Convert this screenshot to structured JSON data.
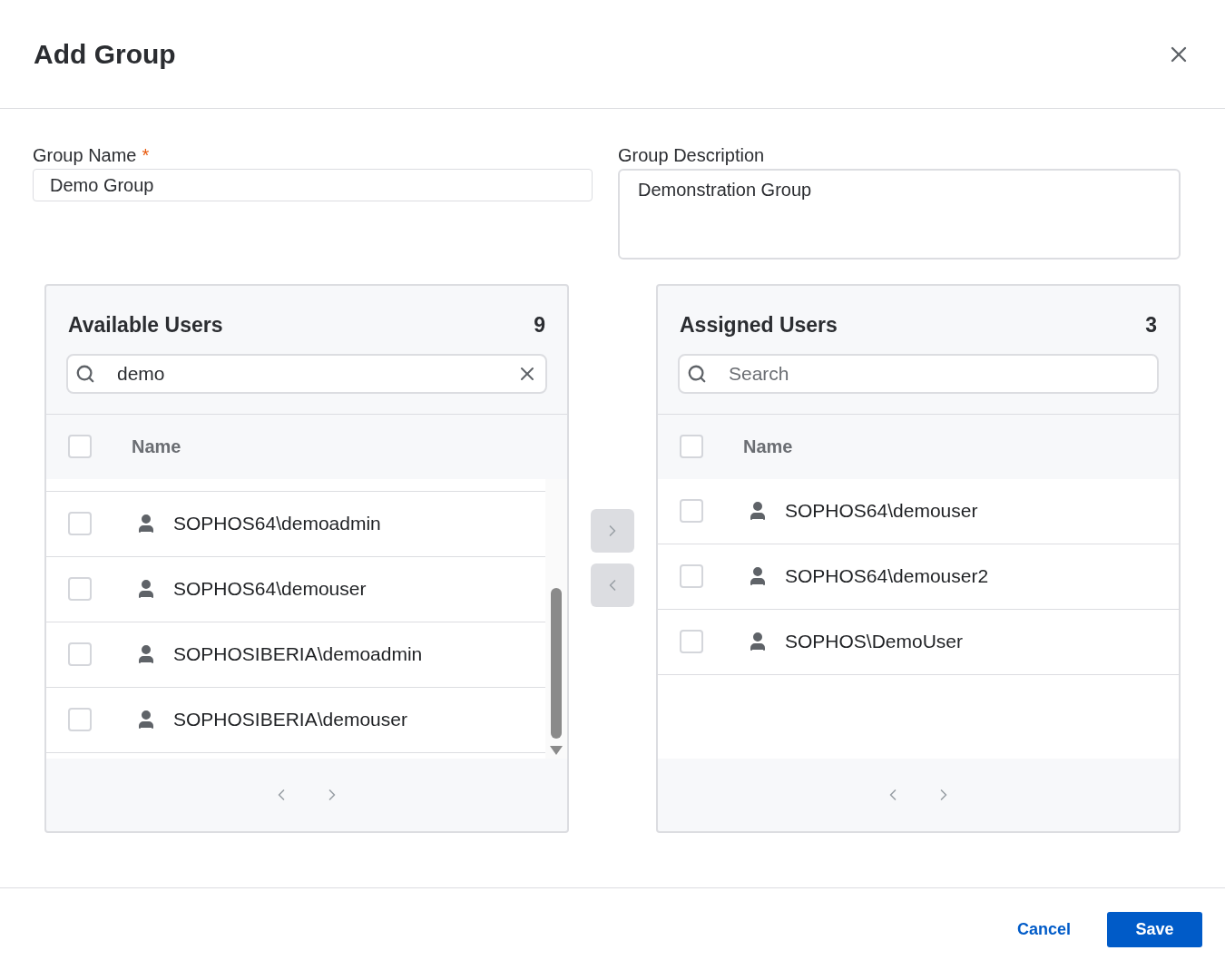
{
  "dialog": {
    "title": "Add Group"
  },
  "fields": {
    "name": {
      "label": "Group Name",
      "required_mark": "*",
      "value": "Demo Group"
    },
    "description": {
      "label": "Group Description",
      "value": "Demonstration Group"
    }
  },
  "panels": [
    {
      "title": "Available Users",
      "count": "9",
      "search": {
        "value": "demo"
      },
      "column": "Name",
      "header_checked": false,
      "scrollbar": true,
      "rows": [
        {
          "name": "SOPHOS64\\demoadmin",
          "checked": false
        },
        {
          "name": "SOPHOS64\\demouser",
          "checked": false
        },
        {
          "name": "SOPHOSIBERIA\\demoadmin",
          "checked": false
        },
        {
          "name": "SOPHOSIBERIA\\demouser",
          "checked": false
        }
      ]
    },
    {
      "title": "Assigned Users",
      "count": "3",
      "search": {
        "placeholder": "Search"
      },
      "column": "Name",
      "header_checked": false,
      "scrollbar": false,
      "rows": [
        {
          "name": "SOPHOS64\\demouser",
          "checked": false
        },
        {
          "name": "SOPHOS64\\demouser2",
          "checked": false
        },
        {
          "name": "SOPHOS\\DemoUser",
          "checked": false
        }
      ]
    }
  ],
  "transfer_buttons": [
    {
      "kind": "add",
      "disabled": true
    },
    {
      "kind": "remove",
      "disabled": true
    }
  ],
  "footer": {
    "cancel": "Cancel",
    "save": "Save"
  }
}
